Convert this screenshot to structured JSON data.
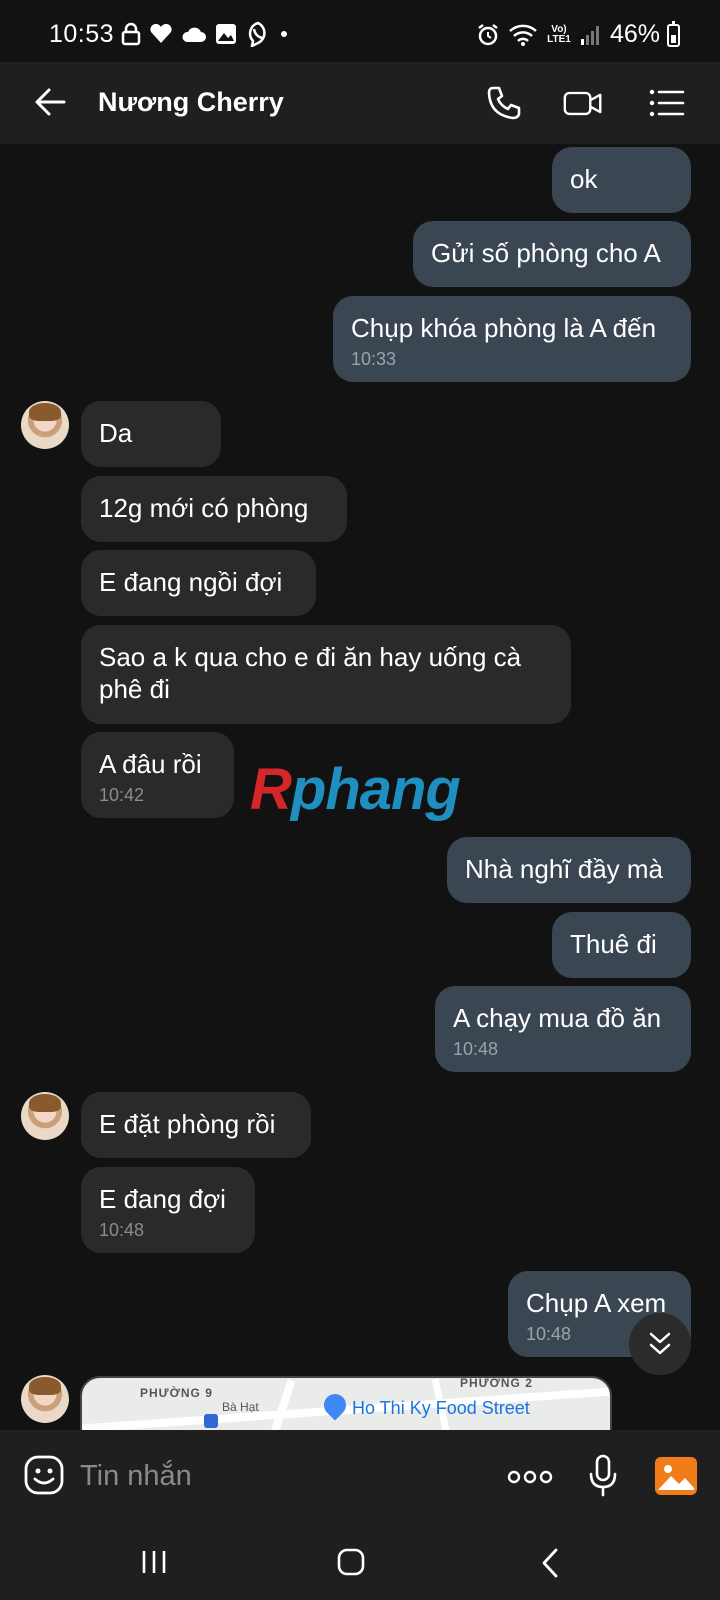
{
  "status_bar": {
    "time": "10:53",
    "network": "Vo) LTE1",
    "battery": "46%"
  },
  "header": {
    "contact_name": "Nương Cherry"
  },
  "messages": [
    {
      "dir": "out",
      "text": "ok"
    },
    {
      "dir": "out",
      "text": "Gửi số phòng cho A"
    },
    {
      "dir": "out",
      "text": "Chụp khóa phòng là A đến",
      "time": "10:33"
    },
    {
      "dir": "in",
      "text": "Da"
    },
    {
      "dir": "in",
      "text": "12g mới có phòng"
    },
    {
      "dir": "in",
      "text": "E đang ngồi đợi"
    },
    {
      "dir": "in",
      "text": " Sao a k qua cho e đi ăn hay uống cà phê đi"
    },
    {
      "dir": "in",
      "text": "A đâu rồi",
      "time": "10:42"
    },
    {
      "dir": "out",
      "text": "Nhà nghĩ đầy mà"
    },
    {
      "dir": "out",
      "text": "Thuê đi"
    },
    {
      "dir": "out",
      "text": "A chạy mua đồ ăn",
      "time": "10:48"
    },
    {
      "dir": "in",
      "text": "E đặt phòng rồi"
    },
    {
      "dir": "in",
      "text": "E đang đợi",
      "time": "10:48"
    },
    {
      "dir": "out",
      "text": "Chụp A xem",
      "time": "10:48"
    }
  ],
  "watermark": {
    "first": "R",
    "rest": "phang"
  },
  "map_card": {
    "area_label_1": "PHƯỜNG 9",
    "area_label_2": "PHƯỜNG 2",
    "street_label": "Bà Hạt",
    "place": "Ho Thi Ky Food Street"
  },
  "input": {
    "placeholder": "Tin nhắn"
  },
  "colors": {
    "background": "#121212",
    "outgoing_bubble": "#3b4653",
    "incoming_bubble": "#2a2a2a",
    "accent_gallery": "#f07d1a"
  }
}
